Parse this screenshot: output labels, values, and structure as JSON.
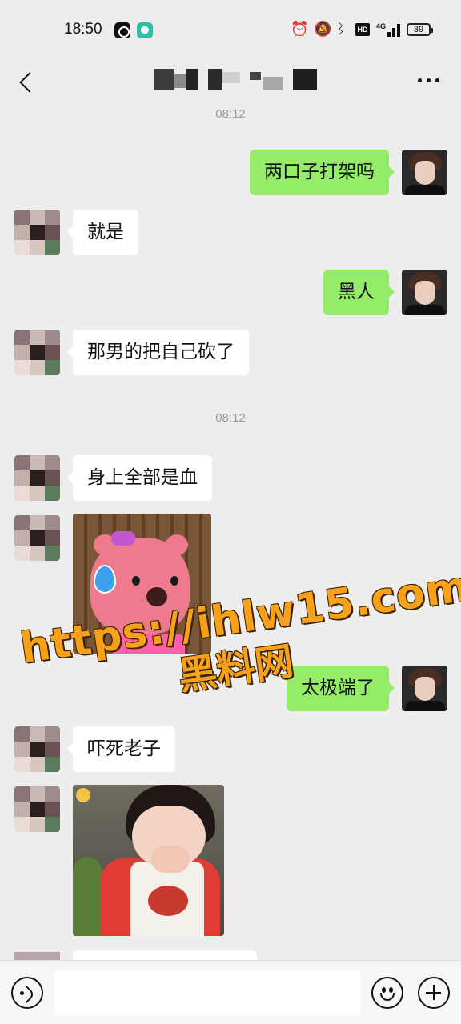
{
  "status_bar": {
    "time": "18:50",
    "hd_label": "HD",
    "network_label": "4G",
    "battery_level": "39"
  },
  "header": {
    "contact_name_redacted": true
  },
  "messages": [
    {
      "type": "timestamp",
      "text": "08:12"
    },
    {
      "type": "text",
      "sender": "me",
      "text": "两口子打架吗"
    },
    {
      "type": "text",
      "sender": "them",
      "text": "就是"
    },
    {
      "type": "text",
      "sender": "me",
      "text": "黑人"
    },
    {
      "type": "text",
      "sender": "them",
      "text": "那男的把自己砍了"
    },
    {
      "type": "timestamp",
      "text": "08:12"
    },
    {
      "type": "text",
      "sender": "them",
      "text": "身上全部是血"
    },
    {
      "type": "sticker",
      "sender": "them",
      "icon": "pink-beaver-sweat-sticker"
    },
    {
      "type": "text",
      "sender": "me",
      "text": "太极端了"
    },
    {
      "type": "text",
      "sender": "them",
      "text": "吓死老子"
    },
    {
      "type": "sticker",
      "sender": "them",
      "icon": "laughing-girl-sticker"
    }
  ],
  "watermark": {
    "url": "https://ihlw15.com",
    "brand": "黑料网"
  },
  "input_bar": {
    "placeholder": "",
    "value": ""
  },
  "colors": {
    "my_bubble": "#95ec69",
    "their_bubble": "#ffffff",
    "background": "#ededed",
    "watermark": "#f7a11a"
  }
}
